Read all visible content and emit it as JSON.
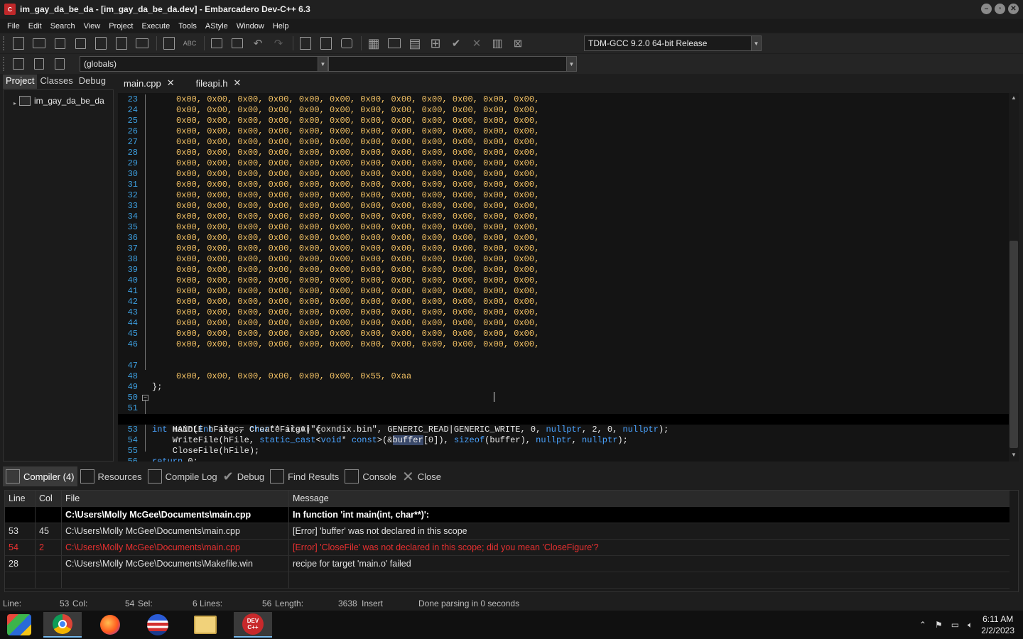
{
  "window": {
    "title": "im_gay_da_be_da - [im_gay_da_be_da.dev] - Embarcadero Dev-C++ 6.3"
  },
  "menu": [
    "File",
    "Edit",
    "Search",
    "View",
    "Project",
    "Execute",
    "Tools",
    "AStyle",
    "Window",
    "Help"
  ],
  "toolbar": {
    "compiler_select": "TDM-GCC 9.2.0 64-bit Release",
    "scope_select": "(globals)",
    "member_select": ""
  },
  "left_panel": {
    "tabs": [
      "Project",
      "Classes",
      "Debug"
    ],
    "tree_root": "im_gay_da_be_da"
  },
  "editor": {
    "tabs": [
      "main.cpp",
      "fileapi.h"
    ],
    "current_line": 53
  },
  "code": {
    "hex_row": "0x00, 0x00, 0x00, 0x00, 0x00, 0x00, 0x00, 0x00, 0x00, 0x00, 0x00, 0x00,",
    "hex_last": "0x00, 0x00, 0x00, 0x00, 0x00, 0x00, 0x55, 0xaa",
    "line48": "};",
    "line51_kw1": "int",
    "line51_rest1": " main(",
    "line51_kw2": "int",
    "line51_rest2": " argc, ",
    "line51_kw3": "char",
    "line51_rest3": "** argv) {",
    "line52_a": "    HANDLE hFile = CreateFileA(\"coxndix.bin\", GENERIC_READ|GENERIC_WRITE, 0, ",
    "line52_kw1": "nullptr",
    "line52_b": ", 2, 0, ",
    "line52_kw2": "nullptr",
    "line52_c": ");",
    "line53_a": "    WriteFile(hFile, ",
    "line53_kw1": "static_cast",
    "line53_b": "<",
    "line53_kw2": "void",
    "line53_c": "* ",
    "line53_kw3": "const",
    "line53_d": ">(&",
    "line53_word": "buffer",
    "line53_e": "[0]), ",
    "line53_kw4": "sizeof",
    "line53_f": "(buffer), ",
    "line53_kw5": "nullptr",
    "line53_g": ", ",
    "line53_kw6": "nullptr",
    "line53_h": ");",
    "line54": "    CloseFile(hFile);",
    "line55_kw": "return",
    "line55_rest": " 0;",
    "line56": "}"
  },
  "bottom_tabs": [
    "Compiler (4)",
    "Resources",
    "Compile Log",
    "Debug",
    "Find Results",
    "Console",
    "Close"
  ],
  "compiler_table": {
    "headers": [
      "Line",
      "Col",
      "File",
      "Message"
    ],
    "rows": [
      {
        "line": "",
        "col": "",
        "file": "C:\\Users\\Molly McGee\\Documents\\main.cpp",
        "message": "In function 'int main(int, char**)':"
      },
      {
        "line": "53",
        "col": "45",
        "file": "C:\\Users\\Molly McGee\\Documents\\main.cpp",
        "message": "[Error] 'buffer' was not declared in this scope"
      },
      {
        "line": "54",
        "col": "2",
        "file": "C:\\Users\\Molly McGee\\Documents\\main.cpp",
        "message": "[Error] 'CloseFile' was not declared in this scope; did you mean 'CloseFigure'?"
      },
      {
        "line": "28",
        "col": "",
        "file": "C:\\Users\\Molly McGee\\Documents\\Makefile.win",
        "message": "recipe for target 'main.o' failed"
      }
    ]
  },
  "status": {
    "line_label": "Line:",
    "line_val": "53",
    "col_label": "Col:",
    "col_val": "54",
    "sel_label": "Sel:",
    "sel_val": "6",
    "lines_label": "Lines:",
    "lines_val": "56",
    "length_label": "Length:",
    "length_val": "3638",
    "mode": "Insert",
    "parse_msg": "Done parsing in 0 seconds"
  },
  "taskbar": {
    "time": "6:11 AM",
    "date": "2/2/2023"
  }
}
